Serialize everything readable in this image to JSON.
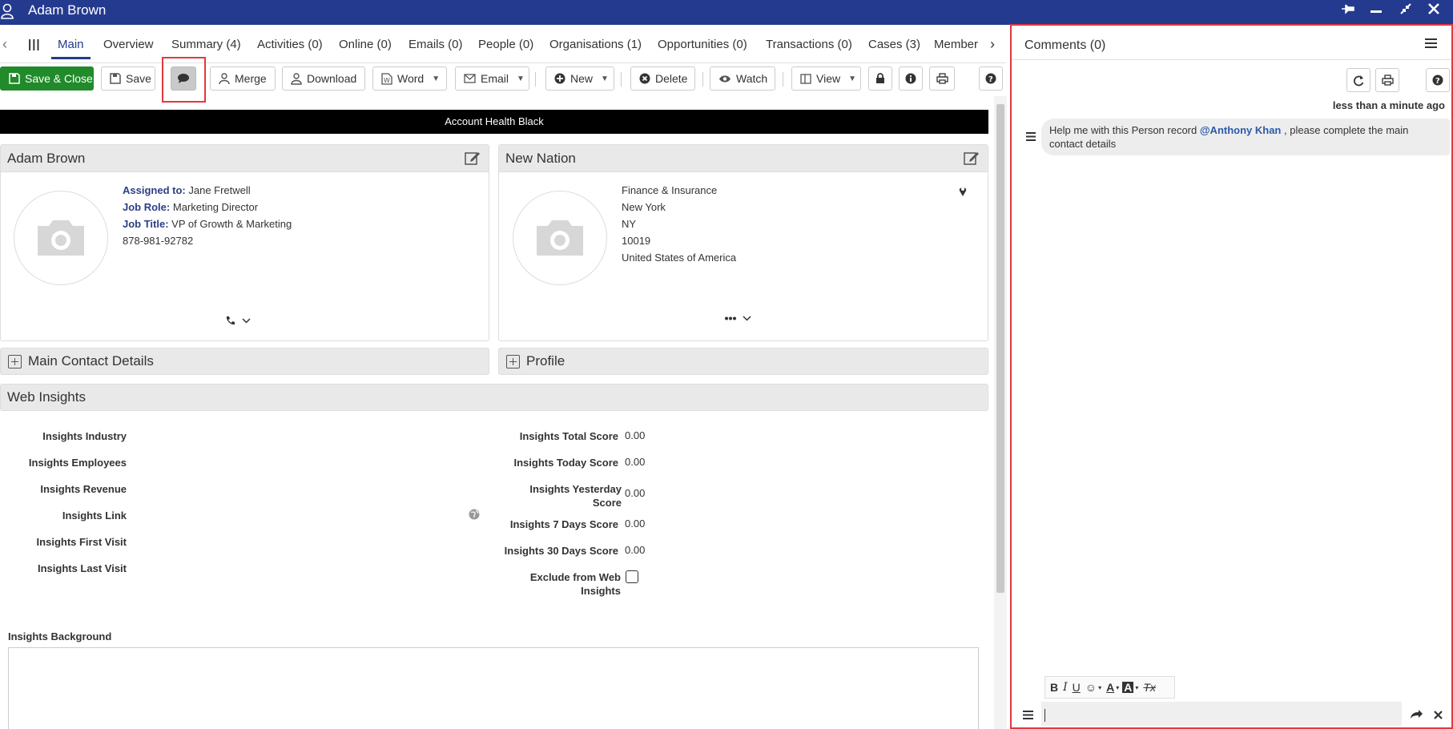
{
  "window": {
    "title": "Adam Brown"
  },
  "tabs": [
    {
      "label": "Main",
      "active": true
    },
    {
      "label": "Overview"
    },
    {
      "label": "Summary (4)"
    },
    {
      "label": "Activities (0)"
    },
    {
      "label": "Online (0)"
    },
    {
      "label": "Emails (0)"
    },
    {
      "label": "People (0)"
    },
    {
      "label": "Organisations (1)"
    },
    {
      "label": "Opportunities (0)"
    },
    {
      "label": "Transactions (0)"
    },
    {
      "label": "Cases (3)"
    },
    {
      "label": "Member"
    }
  ],
  "toolbar": {
    "save_close": "Save & Close",
    "save": "Save",
    "merge": "Merge",
    "download": "Download",
    "word": "Word",
    "email": "Email",
    "new": "New",
    "delete": "Delete",
    "watch": "Watch",
    "view": "View"
  },
  "banner": "Account Health Black",
  "person_card": {
    "name": "Adam Brown",
    "assigned_label": "Assigned to:",
    "assigned_value": "Jane Fretwell",
    "job_role_label": "Job Role:",
    "job_role_value": "Marketing Director",
    "job_title_label": "Job Title:",
    "job_title_value": "VP of Growth & Marketing",
    "phone": "878-981-92782"
  },
  "org_card": {
    "name": "New Nation",
    "industry": "Finance & Insurance",
    "city": "New York",
    "state": "NY",
    "zip": "10019",
    "country": "United States of America"
  },
  "sections": {
    "main_contact": "Main Contact Details",
    "profile": "Profile",
    "web_insights": "Web Insights"
  },
  "insights_left": [
    {
      "label": "Insights Industry"
    },
    {
      "label": "Insights Employees"
    },
    {
      "label": "Insights Revenue"
    },
    {
      "label": "Insights Link"
    },
    {
      "label": "Insights First Visit"
    },
    {
      "label": "Insights Last Visit"
    }
  ],
  "insights_right": [
    {
      "label": "Insights Total Score",
      "value": "0.00"
    },
    {
      "label": "Insights Today Score",
      "value": "0.00"
    },
    {
      "label": "Insights Yesterday Score",
      "value": "0.00"
    },
    {
      "label": "Insights 7 Days Score",
      "value": "0.00"
    },
    {
      "label": "Insights 30 Days Score",
      "value": "0.00"
    },
    {
      "label": "Exclude from Web Insights",
      "value": ""
    }
  ],
  "insights_background_label": "Insights Background",
  "comments": {
    "title": "Comments (0)",
    "time": "less than a minute ago",
    "message_pre": "Help me with this Person record",
    "mention": "@Anthony Khan",
    "message_post": ", please complete the main contact details",
    "tools": [
      "B",
      "I",
      "U",
      "☺",
      "A",
      "A",
      "Tx"
    ]
  },
  "colors": {
    "titlebar": "#243a8f",
    "primary_button": "#218a2a",
    "highlight": "#e0393e",
    "mention": "#2c5aa8"
  }
}
